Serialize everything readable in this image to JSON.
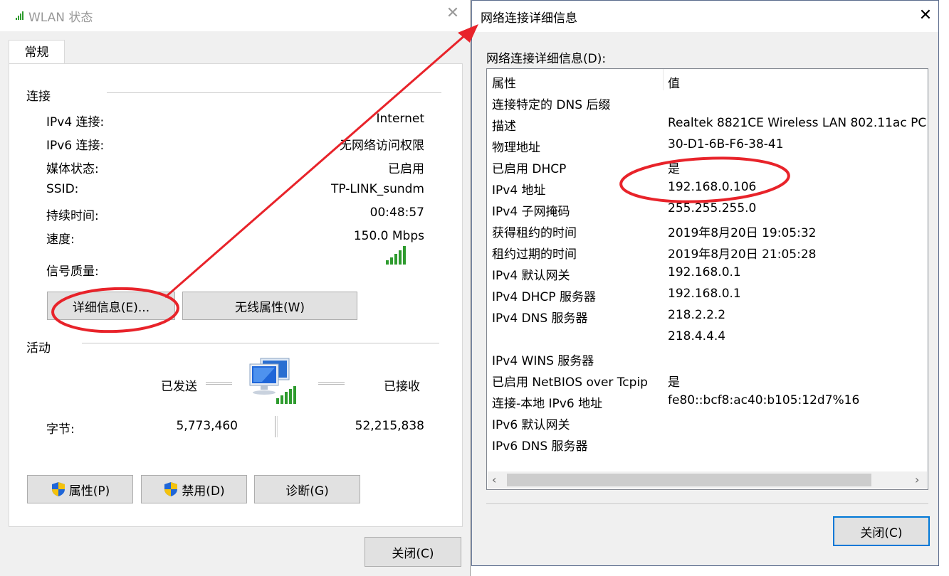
{
  "left_window": {
    "title": "WLAN 状态",
    "tab": "常规",
    "connection_group": "连接",
    "rows": [
      {
        "label": "IPv4 连接:",
        "value": "Internet"
      },
      {
        "label": "IPv6 连接:",
        "value": "无网络访问权限"
      },
      {
        "label": "媒体状态:",
        "value": "已启用"
      },
      {
        "label": "SSID:",
        "value": "TP-LINK_sundm"
      },
      {
        "label": "持续时间:",
        "value": "00:48:57"
      },
      {
        "label": "速度:",
        "value": "150.0 Mbps"
      }
    ],
    "signal_label": "信号质量:",
    "details_button": "详细信息(E)...",
    "wireless_props_button": "无线属性(W)",
    "activity_group": "活动",
    "sent_label": "已发送",
    "received_label": "已接收",
    "bytes_label": "字节:",
    "bytes_sent": "5,773,460",
    "bytes_received": "52,215,838",
    "properties_button": "属性(P)",
    "disable_button": "禁用(D)",
    "diagnose_button": "诊断(G)",
    "close_button": "关闭(C)"
  },
  "right_window": {
    "title": "网络连接详细信息",
    "caption": "网络连接详细信息(D):",
    "col_property": "属性",
    "col_value": "值",
    "rows": [
      {
        "prop": "连接特定的 DNS 后缀",
        "value": ""
      },
      {
        "prop": "描述",
        "value": "Realtek 8821CE Wireless LAN 802.11ac PC"
      },
      {
        "prop": "物理地址",
        "value": "30-D1-6B-F6-38-41"
      },
      {
        "prop": "已启用 DHCP",
        "value": "是"
      },
      {
        "prop": "IPv4 地址",
        "value": "192.168.0.106"
      },
      {
        "prop": "IPv4 子网掩码",
        "value": "255.255.255.0"
      },
      {
        "prop": "获得租约的时间",
        "value": "2019年8月20日 19:05:32"
      },
      {
        "prop": "租约过期的时间",
        "value": "2019年8月20日 21:05:28"
      },
      {
        "prop": "IPv4 默认网关",
        "value": "192.168.0.1"
      },
      {
        "prop": "IPv4 DHCP 服务器",
        "value": "192.168.0.1"
      },
      {
        "prop": "IPv4 DNS 服务器",
        "value": "218.2.2.2"
      },
      {
        "prop": "",
        "value": "218.4.4.4"
      },
      {
        "prop": "IPv4 WINS 服务器",
        "value": ""
      },
      {
        "prop": "已启用 NetBIOS over Tcpip",
        "value": "是"
      },
      {
        "prop": "连接-本地 IPv6 地址",
        "value": "fe80::bcf8:ac40:b105:12d7%16"
      },
      {
        "prop": "IPv6 默认网关",
        "value": ""
      },
      {
        "prop": "IPv6 DNS 服务器",
        "value": ""
      }
    ],
    "close_button": "关闭(C)"
  },
  "colors": {
    "annotation_red": "#e8232a",
    "focus_blue": "#0078d7",
    "signal_green": "#2e9b2e"
  }
}
